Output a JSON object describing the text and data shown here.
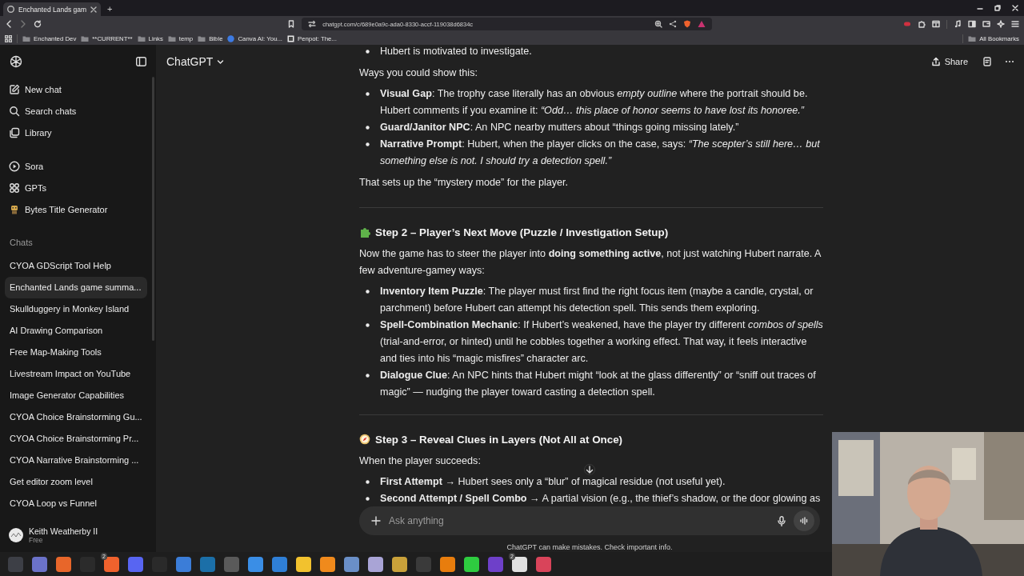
{
  "browser": {
    "tabs": [
      {
        "title": "Enchanted Lands gam",
        "selected": true
      }
    ],
    "new_tab": "+",
    "url": "chatgpt.com/c/689e0a9c-ada0-8330-accf-119038d6834c",
    "bookmarks": [
      {
        "label": "Enchanted Dev"
      },
      {
        "label": "**CURRENT**"
      },
      {
        "label": "Links"
      },
      {
        "label": "temp"
      },
      {
        "label": "Bible"
      },
      {
        "label": "Canva AI: You..."
      },
      {
        "label": "Penpot: The..."
      }
    ],
    "all_bookmarks": "All Bookmarks"
  },
  "sidebar": {
    "nav": [
      {
        "label": "New chat"
      },
      {
        "label": "Search chats"
      },
      {
        "label": "Library"
      }
    ],
    "gpts": [
      {
        "label": "Sora"
      },
      {
        "label": "GPTs"
      },
      {
        "label": "Bytes Title Generator"
      }
    ],
    "chats_heading": "Chats",
    "chats": [
      {
        "label": "CYOA GDScript Tool Help",
        "selected": false
      },
      {
        "label": "Enchanted Lands game summa...",
        "selected": true
      },
      {
        "label": "Skullduggery in Monkey Island",
        "selected": false
      },
      {
        "label": "AI Drawing Comparison",
        "selected": false
      },
      {
        "label": "Free Map-Making Tools",
        "selected": false
      },
      {
        "label": "Livestream Impact on YouTube",
        "selected": false
      },
      {
        "label": "Image Generator Capabilities",
        "selected": false
      },
      {
        "label": "CYOA Choice Brainstorming Gu...",
        "selected": false
      },
      {
        "label": "CYOA Choice Brainstorming Pr...",
        "selected": false
      },
      {
        "label": "CYOA Narrative Brainstorming ...",
        "selected": false
      },
      {
        "label": "Get editor zoom level",
        "selected": false
      },
      {
        "label": "CYOA Loop vs Funnel",
        "selected": false
      }
    ],
    "user": {
      "name": "Keith Weatherby II",
      "plan": "Free"
    }
  },
  "header": {
    "title": "ChatGPT",
    "share": "Share"
  },
  "content": [
    {
      "kind": "list",
      "items": [
        "Hubert is motivated to investigate."
      ]
    },
    {
      "kind": "paragraph",
      "text": "Ways you could show this:"
    },
    {
      "kind": "list",
      "items": [
        "**Visual Gap**: The trophy case literally has an obvious *empty outline* where the portrait should be. Hubert comments if you examine it: *“Odd… this place of honor seems to have lost its honoree.”*",
        "**Guard/Janitor NPC**: An NPC nearby mutters about “things going missing lately.”",
        "**Narrative Prompt**: Hubert, when the player clicks on the case, says: *“The scepter’s still here… but something else is not. I should try a detection spell.”*"
      ]
    },
    {
      "kind": "paragraph",
      "text": "That sets up the “mystery mode” for the player."
    },
    {
      "kind": "rule"
    },
    {
      "kind": "heading",
      "text": "Step 2 – Player’s Next Move (Puzzle / Investigation Setup)"
    },
    {
      "kind": "paragraph",
      "text": "Now the game has to steer the player into **doing something active**, not just watching Hubert narrate. A few adventure-gamey ways:"
    },
    {
      "kind": "list",
      "items": [
        "**Inventory Item Puzzle**: The player must first find the right focus item (maybe a candle, crystal, or parchment) before Hubert can attempt his detection spell. This sends them exploring.",
        "**Spell-Combination Mechanic**: If Hubert’s weakened, have the player try different *combos of spells* (trial-and-error, or hinted) until he cobbles together a working effect. That way, it feels interactive and ties into his “magic misfires” character arc.",
        "**Dialogue Clue**: An NPC hints that Hubert might “look at the glass differently” or “sniff out traces of magic” — nudging the player toward casting a detection spell."
      ]
    },
    {
      "kind": "rule"
    },
    {
      "kind": "heading",
      "text": "Step 3 – Reveal Clues in Layers (Not All at Once)"
    },
    {
      "kind": "paragraph",
      "text": "When the player succeeds:"
    },
    {
      "kind": "list",
      "items": [
        "**First Attempt** → Hubert sees only a “blur” of magical residue (not useful yet).",
        "**Second Attempt / Spell Combo** → A partial vision (e.g., the thief’s shadow, or the door glowing as"
      ]
    }
  ],
  "composer": {
    "placeholder": "Ask anything",
    "disclaimer": "ChatGPT can make mistakes. Check important info."
  },
  "taskbar": {
    "apps": [
      {
        "color": "#3d3f46"
      },
      {
        "color": "#6b72c9"
      },
      {
        "color": "#e8662a"
      },
      {
        "color": "#2b2b2b"
      },
      {
        "color": "#f0622d",
        "badge": "2"
      },
      {
        "color": "#5865f2"
      },
      {
        "color": "#2a2a2a"
      },
      {
        "color": "#3b7dd8"
      },
      {
        "color": "#1b6fa8"
      },
      {
        "color": "#5a5a5a"
      },
      {
        "color": "#3a8ee6"
      },
      {
        "color": "#2f7fd6"
      },
      {
        "color": "#f2c22e"
      },
      {
        "color": "#f08a1c"
      },
      {
        "color": "#6a8fc7"
      },
      {
        "color": "#a9a4d6"
      },
      {
        "color": "#c9a13a"
      },
      {
        "color": "#3a3a3a"
      },
      {
        "color": "#e87d0d"
      },
      {
        "color": "#2ecc40"
      },
      {
        "color": "#6e40c9"
      },
      {
        "color": "#e0e0e0",
        "badge": "2"
      },
      {
        "color": "#d9445a"
      }
    ]
  }
}
